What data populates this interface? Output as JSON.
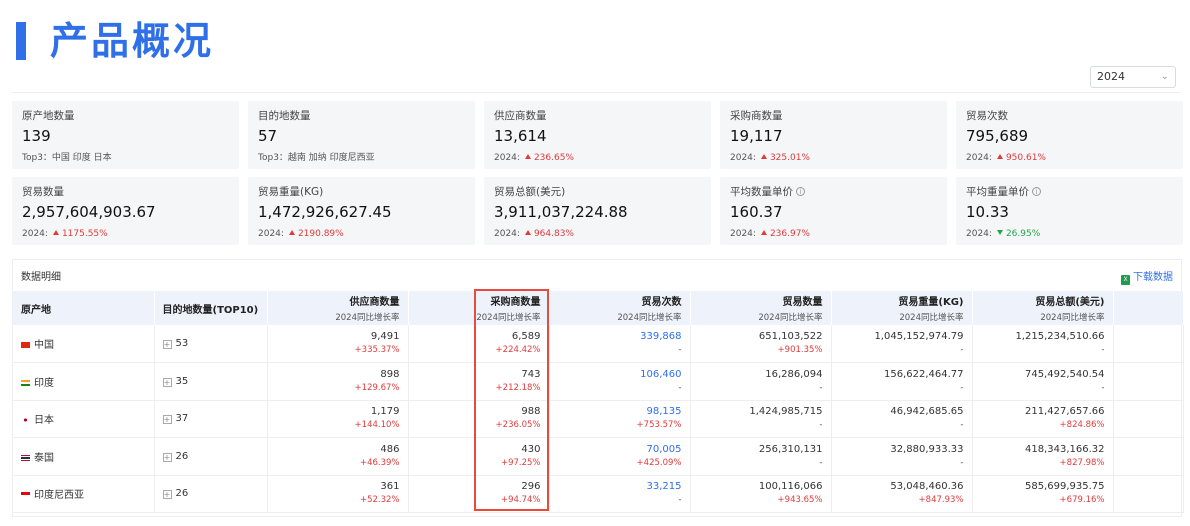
{
  "page": {
    "title": "产品概况",
    "year_select": "2024"
  },
  "cards": [
    {
      "label": "原产地数量",
      "value": "139",
      "sub_text": "Top3：中国 印度 日本"
    },
    {
      "label": "目的地数量",
      "value": "57",
      "sub_text": "Top3：越南 加纳 印度尼西亚"
    },
    {
      "label": "供应商数量",
      "value": "13,614",
      "year": "2024:",
      "trend": "up",
      "change": "236.65%"
    },
    {
      "label": "采购商数量",
      "value": "19,117",
      "year": "2024:",
      "trend": "up",
      "change": "325.01%"
    },
    {
      "label": "贸易次数",
      "value": "795,689",
      "year": "2024:",
      "trend": "up",
      "change": "950.61%"
    },
    {
      "label": "贸易数量",
      "value": "2,957,604,903.67",
      "year": "2024:",
      "trend": "up",
      "change": "1175.55%"
    },
    {
      "label": "贸易重量(KG)",
      "value": "1,472,926,627.45",
      "year": "2024:",
      "trend": "up",
      "change": "2190.89%"
    },
    {
      "label": "贸易总额(美元)",
      "value": "3,911,037,224.88",
      "year": "2024:",
      "trend": "up",
      "change": "964.83%"
    },
    {
      "label": "平均数量单价",
      "info": "i",
      "value": "160.37",
      "year": "2024:",
      "trend": "up",
      "change": "236.97%"
    },
    {
      "label": "平均重量单价",
      "info": "i",
      "value": "10.33",
      "year": "2024:",
      "trend": "down",
      "change": "26.95%"
    }
  ],
  "detail": {
    "title": "数据明细",
    "download_label": "下载数据",
    "download_icon": "excel-icon",
    "columns": [
      {
        "label": "原产地"
      },
      {
        "label": "目的地数量(TOP10)"
      },
      {
        "label": "供应商数量",
        "sub": "2024同比增长率"
      },
      {
        "label": "采购商数量",
        "sub": "2024同比增长率"
      },
      {
        "label": "贸易次数",
        "sub": "2024同比增长率"
      },
      {
        "label": "贸易数量",
        "sub": "2024同比增长率"
      },
      {
        "label": "贸易重量(KG)",
        "sub": "2024同比增长率"
      },
      {
        "label": "贸易总额(美元)",
        "sub": "2024同比增长率"
      }
    ],
    "rows": [
      {
        "country": "中国",
        "flag": "china-flag",
        "dest": "53",
        "suppliers": "9,491",
        "suppliers_chg": "+335.37%",
        "buyers": "6,589",
        "buyers_chg": "+224.42%",
        "trades": "339,868",
        "trades_chg": "-",
        "qty": "651,103,522",
        "qty_chg": "+901.35%",
        "weight": "1,045,152,974.79",
        "weight_chg": "-",
        "amount": "1,215,234,510.66",
        "amount_chg": "-"
      },
      {
        "country": "印度",
        "flag": "india-flag",
        "dest": "35",
        "suppliers": "898",
        "suppliers_chg": "+129.67%",
        "buyers": "743",
        "buyers_chg": "+212.18%",
        "trades": "106,460",
        "trades_chg": "-",
        "qty": "16,286,094",
        "qty_chg": "-",
        "weight": "156,622,464.77",
        "weight_chg": "-",
        "amount": "745,492,540.54",
        "amount_chg": "-"
      },
      {
        "country": "日本",
        "flag": "japan-flag",
        "dest": "37",
        "suppliers": "1,179",
        "suppliers_chg": "+144.10%",
        "buyers": "988",
        "buyers_chg": "+236.05%",
        "trades": "98,135",
        "trades_chg": "+753.57%",
        "qty": "1,424,985,715",
        "qty_chg": "-",
        "weight": "46,942,685.65",
        "weight_chg": "-",
        "amount": "211,427,657.66",
        "amount_chg": "+824.86%"
      },
      {
        "country": "泰国",
        "flag": "thailand-flag",
        "dest": "26",
        "suppliers": "486",
        "suppliers_chg": "+46.39%",
        "buyers": "430",
        "buyers_chg": "+97.25%",
        "trades": "70,005",
        "trades_chg": "+425.09%",
        "qty": "256,310,131",
        "qty_chg": "-",
        "weight": "32,880,933.33",
        "weight_chg": "-",
        "amount": "418,343,166.32",
        "amount_chg": "+827.98%"
      },
      {
        "country": "印度尼西亚",
        "flag": "indonesia-flag",
        "dest": "26",
        "suppliers": "361",
        "suppliers_chg": "+52.32%",
        "buyers": "296",
        "buyers_chg": "+94.74%",
        "trades": "33,215",
        "trades_chg": "-",
        "qty": "100,116,066",
        "qty_chg": "+943.65%",
        "weight": "53,048,460.36",
        "weight_chg": "+847.93%",
        "amount": "585,699,935.75",
        "amount_chg": "+679.16%"
      }
    ]
  },
  "colors": {
    "accent": "#2f6fe8",
    "up": "#e03a3a",
    "down": "#1fa74a",
    "highlight_border": "#e84a3c",
    "card_bg": "#f5f6f8",
    "header_bg": "#eef2fa"
  }
}
